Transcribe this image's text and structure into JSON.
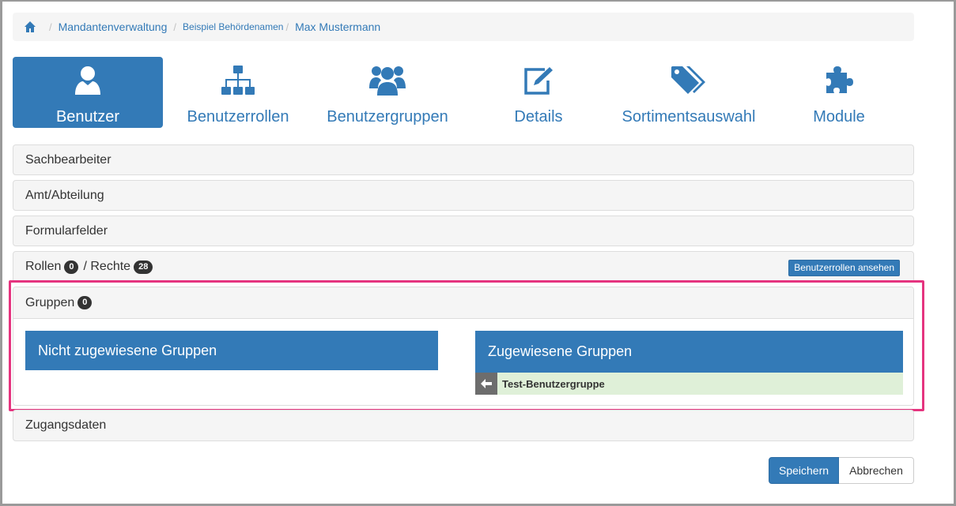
{
  "breadcrumb": {
    "items": [
      "Mandantenverwaltung",
      "Beispiel Behördenamen",
      "Max Mustermann"
    ]
  },
  "tabs": [
    {
      "label": "Benutzer",
      "icon": "user-icon",
      "active": true
    },
    {
      "label": "Benutzerrollen",
      "icon": "sitemap-icon",
      "active": false
    },
    {
      "label": "Benutzergruppen",
      "icon": "users-icon",
      "active": false
    },
    {
      "label": "Details",
      "icon": "edit-icon",
      "active": false
    },
    {
      "label": "Sortimentsauswahl",
      "icon": "tags-icon",
      "active": false
    },
    {
      "label": "Module",
      "icon": "puzzle-icon",
      "active": false
    }
  ],
  "sections": {
    "sachbearbeiter": "Sachbearbeiter",
    "amt": "Amt/Abteilung",
    "formularfelder": "Formularfelder",
    "rollen_label": "Rollen",
    "rollen_count": "0",
    "rechte_label": "/ Rechte",
    "rechte_count": "28",
    "rollen_button": "Benutzerrollen ansehen",
    "gruppen_label": "Gruppen",
    "gruppen_count": "0",
    "zugangsdaten": "Zugangsdaten"
  },
  "groups": {
    "unassigned_title": "Nicht zugewiesene Gruppen",
    "assigned_title": "Zugewiesene Gruppen",
    "assigned_items": [
      "Test-Benutzergruppe"
    ]
  },
  "footer": {
    "save_label": "Speichern",
    "cancel_label": "Abbrechen"
  },
  "colors": {
    "primary": "#337ab7",
    "highlight": "#e5347f",
    "assigned_row": "#dff0d8"
  }
}
